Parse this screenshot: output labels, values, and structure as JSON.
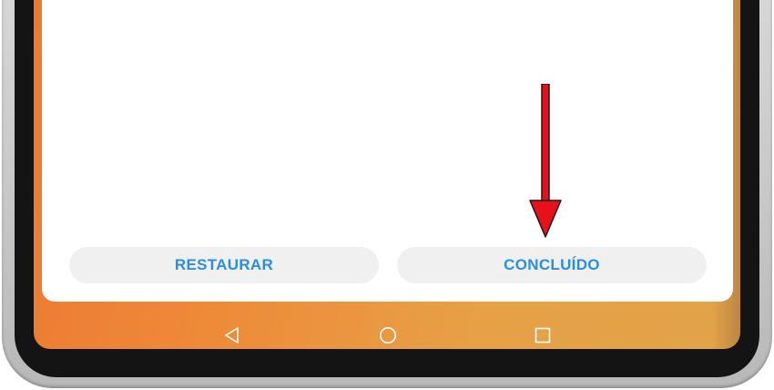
{
  "dialog": {
    "restore_label": "RESTAURAR",
    "done_label": "CONCLUÍDO"
  },
  "navbar": {
    "back_icon": "triangle-back-icon",
    "home_icon": "circle-home-icon",
    "recent_icon": "square-recent-apps-icon"
  },
  "annotation": {
    "arrow_color": "#e8101a",
    "target": "done-button"
  },
  "colors": {
    "button_text": "#2a8ee0",
    "button_bg": "#f0f0f0",
    "wallpaper_start": "#ec7a33",
    "wallpaper_end": "#e1a348"
  }
}
